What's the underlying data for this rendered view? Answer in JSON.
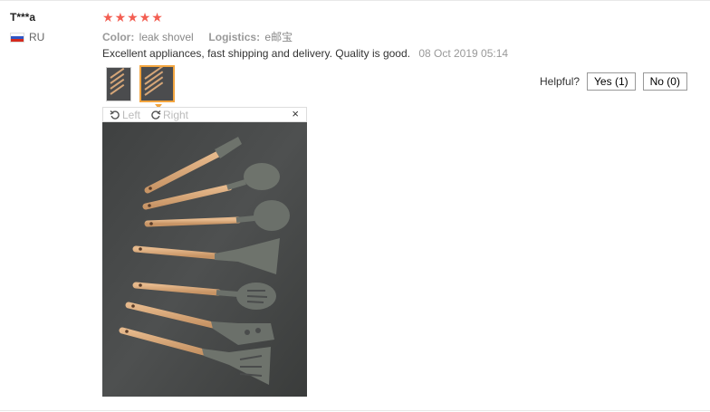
{
  "review": {
    "user": "T***a",
    "country": "RU",
    "rating": 5,
    "color_label": "Color:",
    "color_value": "leak shovel",
    "logistics_label": "Logistics:",
    "logistics_value": "e邮宝",
    "text": "Excellent appliances, fast shipping and delivery. Quality is good.",
    "date": "08 Oct 2019 05:14"
  },
  "helpful": {
    "label": "Helpful?",
    "yes": "Yes (1)",
    "no": "No (0)"
  },
  "viewer": {
    "left": "Left",
    "right": "Right",
    "close": "×"
  },
  "icons": {
    "star": "star-icon",
    "flag": "russia-flag-icon",
    "rotate_left": "rotate-left-icon",
    "rotate_right": "rotate-right-icon",
    "close": "close-icon"
  },
  "colors": {
    "star": "#f35e52",
    "active_thumb": "#f3a53f",
    "handle": "#d6a678",
    "silicone": "#6b7069"
  }
}
